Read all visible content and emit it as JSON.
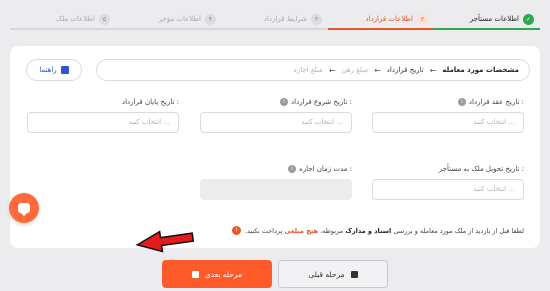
{
  "stepper": {
    "steps": [
      {
        "num": "✓",
        "label": "اطلاعات مستأجر"
      },
      {
        "num": "۲",
        "label": "اطلاعات قرارداد"
      },
      {
        "num": "۳",
        "label": "شرایط قرارداد"
      },
      {
        "num": "۴",
        "label": "اطلاعات مؤجر"
      },
      {
        "num": "۵",
        "label": "اطلاعات ملک"
      }
    ]
  },
  "breadcrumb": {
    "items": [
      "مشخصات مورد معامله",
      "تاریخ قرارداد",
      "مبلغ رهن",
      "مبلغ اجاره"
    ],
    "arrow": "←"
  },
  "guide_button": {
    "label": "راهنما"
  },
  "fields": {
    "contract_date": {
      "label": "تاریخ عقد قرارداد :",
      "placeholder": "انتخاب کنید ..."
    },
    "start_date": {
      "label": "تاریخ شروع قرارداد :",
      "placeholder": "انتخاب کنید ..."
    },
    "end_date": {
      "label": "تاریخ پایان قرارداد :",
      "placeholder": "انتخاب کنید ..."
    },
    "delivery_date": {
      "label": "تاریخ تحویل ملک به مستأجر :",
      "placeholder": "انتخاب کنید ..."
    },
    "lease_term": {
      "label": "مدت زمان اجاره :",
      "placeholder": ""
    }
  },
  "notice": {
    "part1": "لطفا قبل از بازدید از ملک مورد معامله و بررسی",
    "bold1": "اسناد و مدارک",
    "part2": "مربوطه،",
    "bold2": "هیچ مبلغی",
    "part3": "پرداخت نکنید."
  },
  "buttons": {
    "prev": "مرحله قبلی",
    "next": "مرحله بعدی"
  },
  "colors": {
    "accent": "#e7562a",
    "success": "#2fa84f",
    "link": "#2f57c7"
  }
}
